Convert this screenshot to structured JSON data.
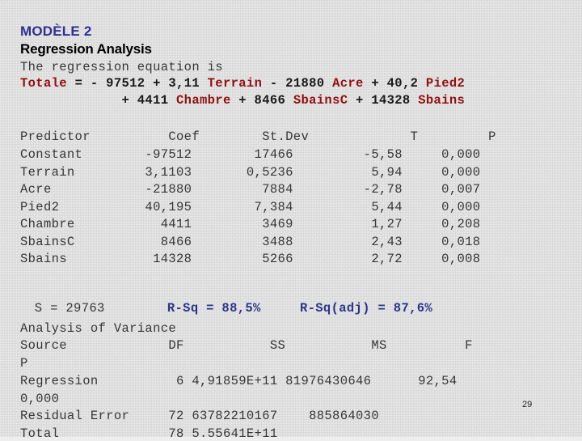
{
  "heading": {
    "model_label": "MODÈLE 2",
    "section_title": "Regression Analysis",
    "model_color": "#33339c",
    "title_color": "#000000"
  },
  "equation": {
    "intro": "The regression equation is",
    "line1_parts": [
      {
        "text": "Totale",
        "kind": "var"
      },
      {
        "text": " = - 97512 + 3,11 ",
        "kind": "num"
      },
      {
        "text": "Terrain",
        "kind": "var"
      },
      {
        "text": " - 21880 ",
        "kind": "num"
      },
      {
        "text": "Acre",
        "kind": "var"
      },
      {
        "text": " + 40,2 ",
        "kind": "num"
      },
      {
        "text": "Pied2",
        "kind": "var"
      }
    ],
    "line2_parts": [
      {
        "text": "             + 4411 ",
        "kind": "num"
      },
      {
        "text": "Chambre",
        "kind": "var"
      },
      {
        "text": " + 8466 ",
        "kind": "num"
      },
      {
        "text": "SbainsC",
        "kind": "var"
      },
      {
        "text": " + 14328 ",
        "kind": "num"
      },
      {
        "text": "Sbains",
        "kind": "var"
      }
    ],
    "variable_color": "#9c1010",
    "number_color": "#1a1a1a"
  },
  "coefficients_table": {
    "header_line": "Predictor          Coef        St.Dev             T         P",
    "rows": [
      "Constant        -97512        17466         -5,58     0,000",
      "Terrain         3,1103       0,5236          5,94     0,000",
      "Acre            -21880         7884         -2,78     0,007",
      "Pied2           40,195        7,384          5,44     0,000",
      "Chambre           4411         3469          1,27     0,208",
      "SbainsC           8466         3488          2,43     0,018",
      "Sbains           14328         5266          2,72     0,008"
    ],
    "columns": [
      "Predictor",
      "Coef",
      "St.Dev",
      "T",
      "P"
    ],
    "data": [
      {
        "predictor": "Constant",
        "coef": "-97512",
        "stdev": "17466",
        "t": "-5,58",
        "p": "0,000"
      },
      {
        "predictor": "Terrain",
        "coef": "3,1103",
        "stdev": "0,5236",
        "t": "5,94",
        "p": "0,000"
      },
      {
        "predictor": "Acre",
        "coef": "-21880",
        "stdev": "7884",
        "t": "-2,78",
        "p": "0,007"
      },
      {
        "predictor": "Pied2",
        "coef": "40,195",
        "stdev": "7,384",
        "t": "5,44",
        "p": "0,000"
      },
      {
        "predictor": "Chambre",
        "coef": "4411",
        "stdev": "3469",
        "t": "1,27",
        "p": "0,208"
      },
      {
        "predictor": "SbainsC",
        "coef": "8466",
        "stdev": "3488",
        "t": "2,43",
        "p": "0,018"
      },
      {
        "predictor": "Sbains",
        "coef": "14328",
        "stdev": "5266",
        "t": "2,72",
        "p": "0,008"
      }
    ]
  },
  "model_stats": {
    "s_label": "S = 29763",
    "rsq_label": "R-Sq = 88,5%",
    "rsq_adj_label": "R-Sq(adj) = 87,6%",
    "rsq_color": "#2b3a92"
  },
  "anova": {
    "title": "Analysis of Variance",
    "header_line1": "Source             DF           SS           MS          F",
    "header_line2": "P",
    "rows": [
      "Regression          6 4,91859E+11 81976430646      92,54",
      "0,000",
      "Residual Error     72 63782210167    885864030",
      "Total              78 5.55641E+11"
    ],
    "columns": [
      "Source",
      "DF",
      "SS",
      "MS",
      "F",
      "P"
    ],
    "data": [
      {
        "source": "Regression",
        "df": "6",
        "ss": "4,91859E+11",
        "ms": "81976430646",
        "f": "92,54",
        "p": "0,000"
      },
      {
        "source": "Residual Error",
        "df": "72",
        "ss": "63782210167",
        "ms": "885864030",
        "f": "",
        "p": ""
      },
      {
        "source": "Total",
        "df": "78",
        "ss": "5.55641E+11",
        "ms": "",
        "f": "",
        "p": ""
      }
    ]
  },
  "footer": {
    "page_number": "29"
  }
}
